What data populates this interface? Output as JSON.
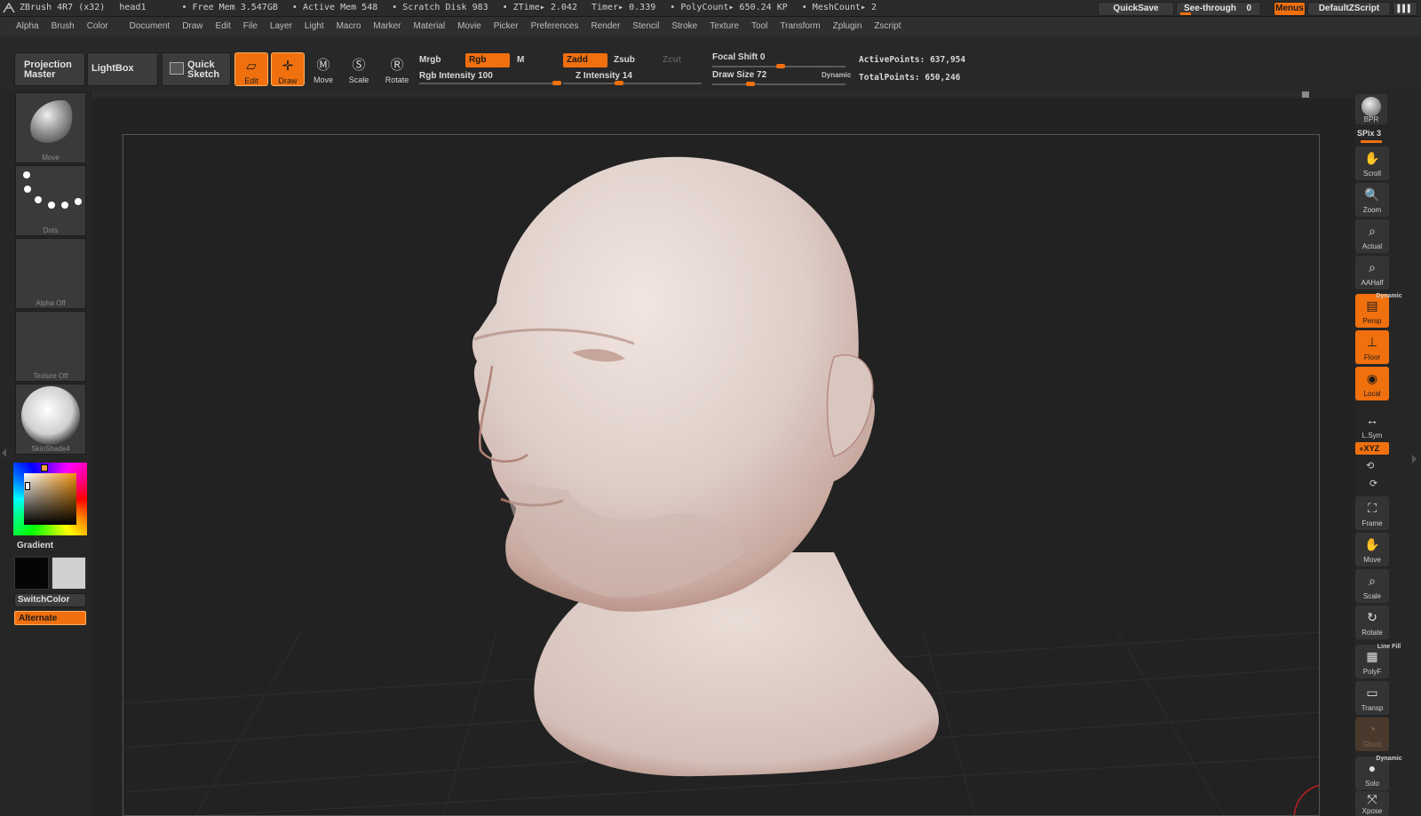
{
  "titlebar": {
    "app": "ZBrush 4R7 (x32)",
    "doc": "head1",
    "stats": [
      "• Free Mem 3.547GB",
      "• Active Mem 548",
      "• Scratch Disk 983",
      "• ZTime▸ 2.042",
      "Timer▸ 0.339",
      "• PolyCount▸ 650.24 KP",
      "• MeshCount▸ 2"
    ],
    "quicksave": "QuickSave",
    "see_through": "See-through",
    "see_through_value": "0",
    "menus": "Menus",
    "script": "DefaultZScript"
  },
  "menu": [
    "Alpha",
    "Brush",
    "Color",
    "Document",
    "Draw",
    "Edit",
    "File",
    "Layer",
    "Light",
    "Macro",
    "Marker",
    "Material",
    "Movie",
    "Picker",
    "Preferences",
    "Render",
    "Stencil",
    "Stroke",
    "Texture",
    "Tool",
    "Transform",
    "Zplugin",
    "Zscript"
  ],
  "shelf": {
    "projection_master_l1": "Projection",
    "projection_master_l2": "Master",
    "lightbox": "LightBox",
    "quick_sketch_l1": "Quick",
    "quick_sketch_l2": "Sketch",
    "edit": "Edit",
    "draw": "Draw",
    "move": "Move",
    "scale": "Scale",
    "rotate": "Rotate",
    "mrgb": "Mrgb",
    "rgb": "Rgb",
    "m": "M",
    "zadd": "Zadd",
    "zsub": "Zsub",
    "zcut": "Zcut",
    "rgb_intensity": "Rgb Intensity 100",
    "z_intensity": "Z Intensity 14",
    "focal_shift": "Focal Shift 0",
    "draw_size": "Draw Size 72",
    "dynamic": "Dynamic",
    "active_points": "ActivePoints: 637,954",
    "total_points": "TotalPoints: 650,246"
  },
  "left": {
    "brush_cap": "Move",
    "stroke_cap": "Dots",
    "alpha_cap": "Alpha  Off",
    "texture_cap": "Texture  Off",
    "material_cap": "SkinShade4",
    "gradient": "Gradient",
    "switch_color": "SwitchColor",
    "alternate": "Alternate"
  },
  "right": {
    "bpr": "BPR",
    "spix": "SPix 3",
    "scroll": "Scroll",
    "zoom": "Zoom",
    "actual": "Actual",
    "aahalf": "AAHalf",
    "dynamic": "Dynamic",
    "persp": "Persp",
    "floor": "Floor",
    "local": "Local",
    "lsym": "L.Sym",
    "xyz": "∘XYZ",
    "frame": "Frame",
    "move": "Move",
    "scale": "Scale",
    "rotate": "Rotate",
    "line_fill": "Line Fill",
    "polyf": "PolyF",
    "transp": "Transp",
    "ghost": "Ghost",
    "dynamic2": "Dynamic",
    "solo": "Solo",
    "xpose": "Xpose"
  },
  "colors": {
    "accent": "#f0700e",
    "bg": "#1b1b1b",
    "model": "#e6d8d2"
  }
}
